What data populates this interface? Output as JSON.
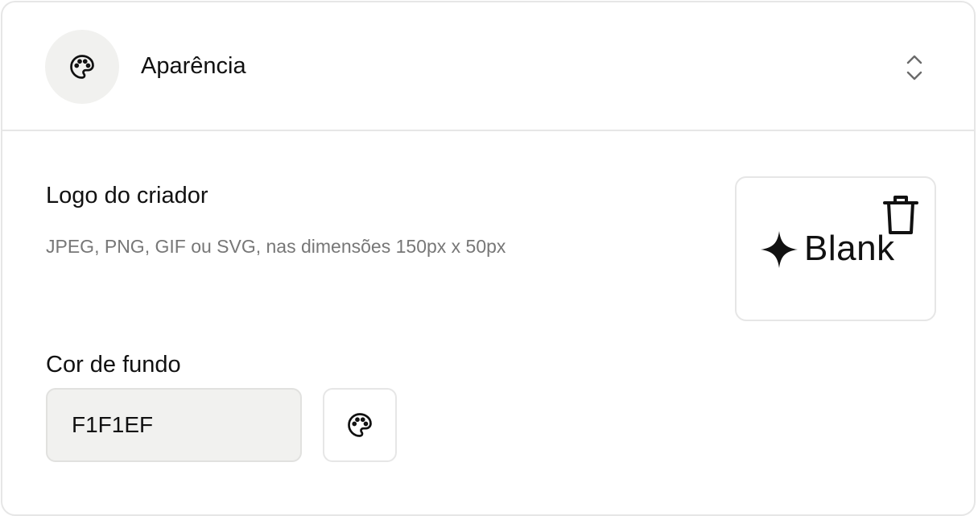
{
  "appearance": {
    "title": "Aparência",
    "header_icon": "palette-icon",
    "toggle_icon": "chevron-up-down-icon"
  },
  "logo": {
    "title": "Logo do criador",
    "help_text": "JPEG, PNG, GIF ou SVG, nas dimensões 150px x 50px",
    "brand_text": "Blank",
    "brand_icon": "sparkle-star-icon",
    "delete_icon": "trash-icon"
  },
  "background": {
    "title": "Cor de fundo",
    "value": "F1F1EF",
    "picker_icon": "palette-icon"
  },
  "colors": {
    "text": "#111111",
    "muted": "#777777",
    "border": "#e6e6e6",
    "input_bg": "#f1f1ef"
  }
}
